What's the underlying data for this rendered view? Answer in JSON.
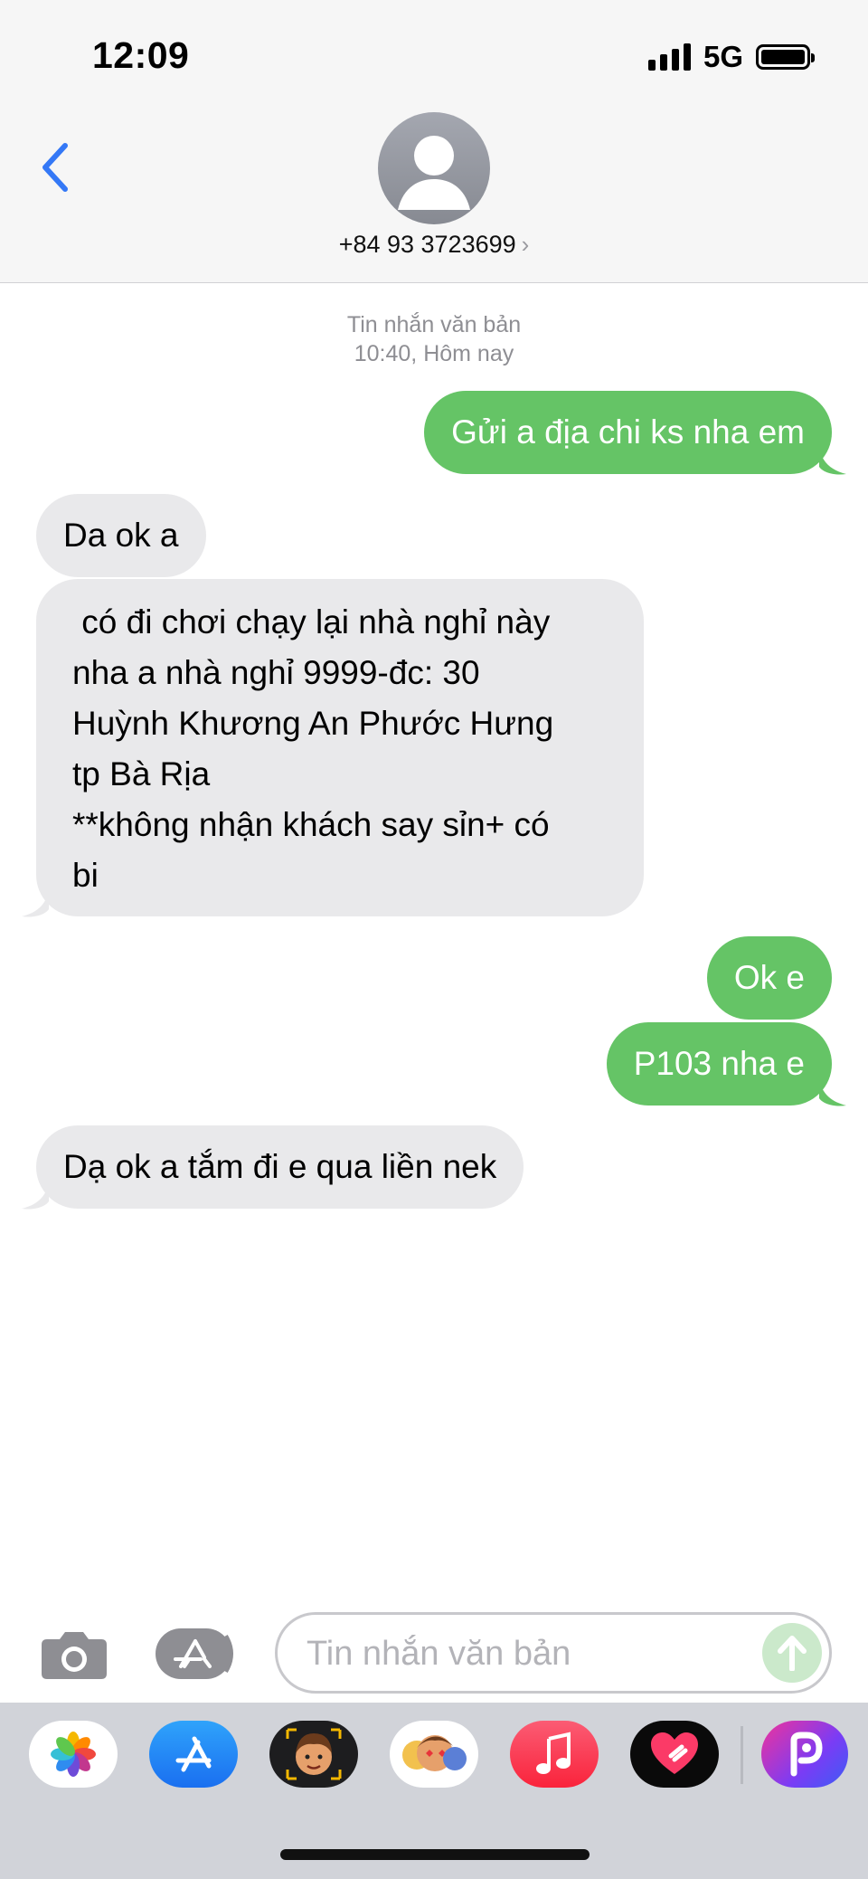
{
  "status_bar": {
    "time": "12:09",
    "network": "5G"
  },
  "header": {
    "contact_number": "+84 93 3723699",
    "contact_chevron": "›"
  },
  "thread": {
    "meta_label": "Tin nhắn văn bản",
    "meta_time": "10:40, Hôm nay",
    "messages": [
      {
        "direction": "out",
        "text": "Gửi a địa chi ks nha em"
      },
      {
        "direction": "in",
        "text": "Da ok a"
      },
      {
        "direction": "in",
        "text": " có đi chơi chạy lại nhà nghỉ này\nnha a nhà nghỉ 9999-đc: 30\nHuỳnh Khương An Phước Hưng\ntp Bà Rịa\n**không nhận khách say sỉn+ có\nbi"
      },
      {
        "direction": "out",
        "text": "Ok e"
      },
      {
        "direction": "out",
        "text": "P103 nha e"
      },
      {
        "direction": "in",
        "text": "Dạ ok a tắm đi e qua liền nek"
      }
    ]
  },
  "composer": {
    "placeholder": "Tin nhắn văn bản"
  },
  "colors": {
    "outgoing": "#65c466",
    "incoming": "#e9e9eb",
    "accent": "#3478f6"
  },
  "dock_apps": [
    "photos-icon",
    "app-store-icon",
    "memoji-icon",
    "animoji-stickers-icon",
    "music-icon",
    "digital-touch-icon",
    "picsart-icon"
  ]
}
